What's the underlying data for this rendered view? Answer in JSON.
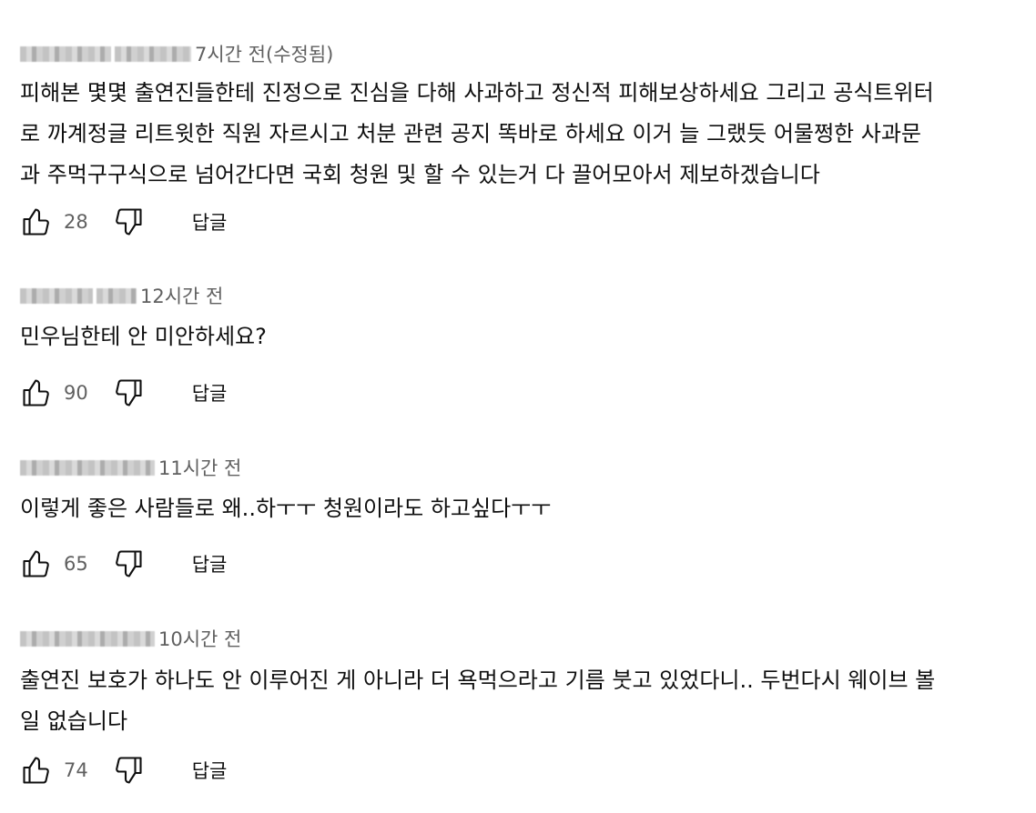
{
  "comments": [
    {
      "time": "7시간 전(수정됨)",
      "text_lines": [
        "피해본 몇몇 출연진들한테 진정으로 진심을 다해 사과하고 정신적 피해보상하세요 그리고 공식트위터",
        "로 까계정글 리트윗한 직원 자르시고 처분 관련 공지 똑바로 하세요 이거 늘 그랬듯 어물쩡한 사과문",
        "과 주먹구구식으로 넘어간다면 국회 청원 및 할 수 있는거 다 끌어모아서 제보하겠습니다"
      ],
      "likes": "28",
      "reply_label": "답글"
    },
    {
      "time": "12시간 전",
      "text_lines": [
        "민우님한테 안 미안하세요?"
      ],
      "likes": "90",
      "reply_label": "답글"
    },
    {
      "time": "11시간 전",
      "text_lines": [
        "이렇게 좋은 사람들로 왜..하ㅜㅜ 청원이라도 하고싶다ㅜㅜ"
      ],
      "likes": "65",
      "reply_label": "답글"
    },
    {
      "time": "10시간 전",
      "text_lines": [
        "출연진 보호가 하나도 안 이루어진 게 아니라 더 욕먹으라고 기름 붓고 있었다니.. 두번다시 웨이브 볼",
        "일 없습니다"
      ],
      "likes": "74",
      "reply_label": "답글"
    }
  ],
  "icons": {
    "like": "thumb-up-icon",
    "dislike": "thumb-down-icon"
  },
  "colors": {
    "text": "#0f0f0f",
    "secondary": "#606060"
  }
}
